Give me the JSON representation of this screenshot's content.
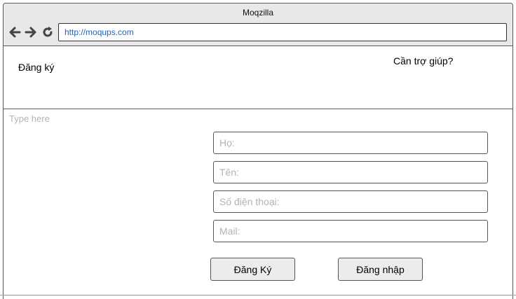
{
  "browser": {
    "title": "Moqzilla",
    "url": "http://moqups.com",
    "icons": [
      "back-arrow-icon",
      "forward-arrow-icon",
      "reload-icon"
    ]
  },
  "header": {
    "title": "Đăng ký",
    "help": "Cần trợ giúp?"
  },
  "content": {
    "placeholder_text": "Type here"
  },
  "form": {
    "last_name_placeholder": "Họ:",
    "first_name_placeholder": "Tên:",
    "phone_placeholder": "Số điện thoại:",
    "mail_placeholder": "Mail:",
    "register_label": "Đăng Ký",
    "login_label": "Đăng nhập"
  },
  "colors": {
    "titlebar": "#e8e8e8",
    "url_text": "#1a63c8",
    "border": "#5a5a5a",
    "button_bg": "#ececec",
    "placeholder": "#b3b3b3"
  }
}
